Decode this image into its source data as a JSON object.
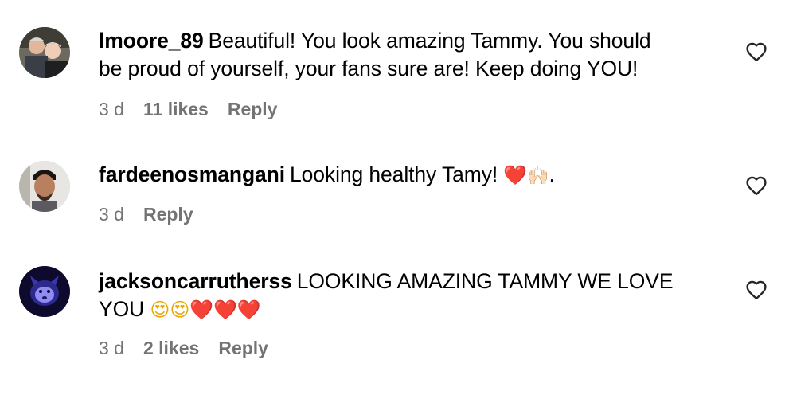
{
  "comments": [
    {
      "username": "lmoore_89",
      "text_lines": [
        "Beautiful! You look amazing Tammy. You should",
        "be proud of yourself, your fans sure are! Keep doing YOU!"
      ],
      "emojis": [],
      "time": "3 d",
      "likes": "11 likes",
      "reply": "Reply",
      "avatar": "couple-photo"
    },
    {
      "username": "fardeenosmangani",
      "text_lines": [
        "Looking healthy Tamy!"
      ],
      "emojis": [
        "❤️",
        "🙌🏻"
      ],
      "trailing": ".",
      "time": "3 d",
      "reply": "Reply",
      "avatar": "man-portrait"
    },
    {
      "username": "jacksoncarrutherss",
      "text_lines": [
        "LOOKING AMAZING TAMMY WE LOVE",
        "YOU"
      ],
      "emojis": [
        "😍",
        "😍",
        "❤️",
        "❤️",
        "❤️"
      ],
      "time": "3 d",
      "likes": "2 likes",
      "reply": "Reply",
      "avatar": "dark-blue-photo"
    }
  ],
  "colors": {
    "meta": "#737373",
    "heart": "#e0262f"
  },
  "icons": {
    "like": "heart-outline-icon"
  }
}
